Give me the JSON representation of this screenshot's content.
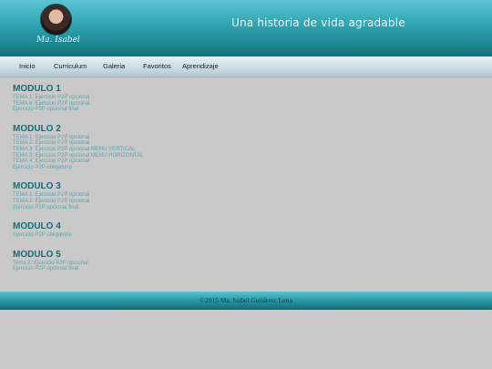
{
  "header": {
    "avatar_icon": "profile-photo",
    "signature": "Ma. Isabel",
    "site_title": "Una historia de vida agradable"
  },
  "nav": {
    "items": [
      {
        "label": "Inicio"
      },
      {
        "label": "Curriculum"
      },
      {
        "label": "Galeria"
      },
      {
        "label": "Favoritos"
      },
      {
        "label": "Aprendizaje"
      }
    ]
  },
  "modules": [
    {
      "title": "MODULO 1",
      "links": [
        "TEMA 1: Ejercicio P2P opcional",
        "TEMA 6: Ejercicio P2P opcional",
        "Ejercicio P2P opcional final"
      ]
    },
    {
      "title": "MODULO 2",
      "links": [
        "TEMA 1: Ejercicio P2P opcional",
        "TEMA 2: Ejercicio P2P opcional",
        "TEMA 3: Ejercicio P2P opcional MENU VERTICAL",
        "TEMA 3: Ejercicio P2P opcional MENU HORIZONTAL",
        "TEMA 4: Ejercicio P2P opcional",
        "Ejercicio P2P obligatorio"
      ]
    },
    {
      "title": "MODULO 3",
      "links": [
        "TEMA 1: Ejercicio P2P opcional",
        "TEMA 2: Ejercicio P2P opcional",
        "Ejercicio P2P opcional final"
      ]
    },
    {
      "title": "MODULO 4",
      "links": [
        "Ejercicio P2P obligatorio"
      ]
    },
    {
      "title": "MODULO 5",
      "links": [
        "Tema 2: Ejercicio P2P opcional",
        "Ejercicio P2P opcional final"
      ]
    }
  ],
  "footer": {
    "text": "©2015 Ma. Isabel Gutiérrez Luna"
  },
  "colors": {
    "header_teal": "#2fa3b0",
    "module_title": "#146f78",
    "link": "#5ba5ae",
    "page_bg": "#c9c9c9"
  }
}
